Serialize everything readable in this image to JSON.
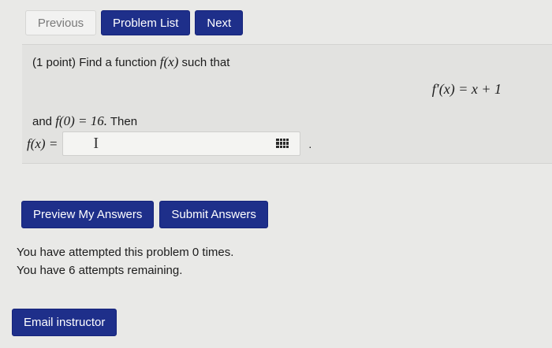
{
  "nav": {
    "previous_label": "Previous",
    "problem_list_label": "Problem List",
    "next_label": "Next"
  },
  "problem": {
    "prefix": "(1 point) Find a function ",
    "function_name": "f(x)",
    "suffix": " such that",
    "equation": "f′(x) = x + 1",
    "condition_prefix": "and ",
    "condition_math": "f(0) = 16.",
    "condition_suffix": " Then",
    "answer_label": "f(x) =",
    "answer_value": "",
    "trailing_punct": "."
  },
  "actions": {
    "preview_label": "Preview My Answers",
    "submit_label": "Submit Answers"
  },
  "status": {
    "attempts_line": "You have attempted this problem 0 times.",
    "remaining_line": "You have 6 attempts remaining."
  },
  "footer": {
    "email_label": "Email instructor"
  },
  "colors": {
    "button_primary": "#1e2f8a",
    "page_background": "#e9e9e7"
  }
}
